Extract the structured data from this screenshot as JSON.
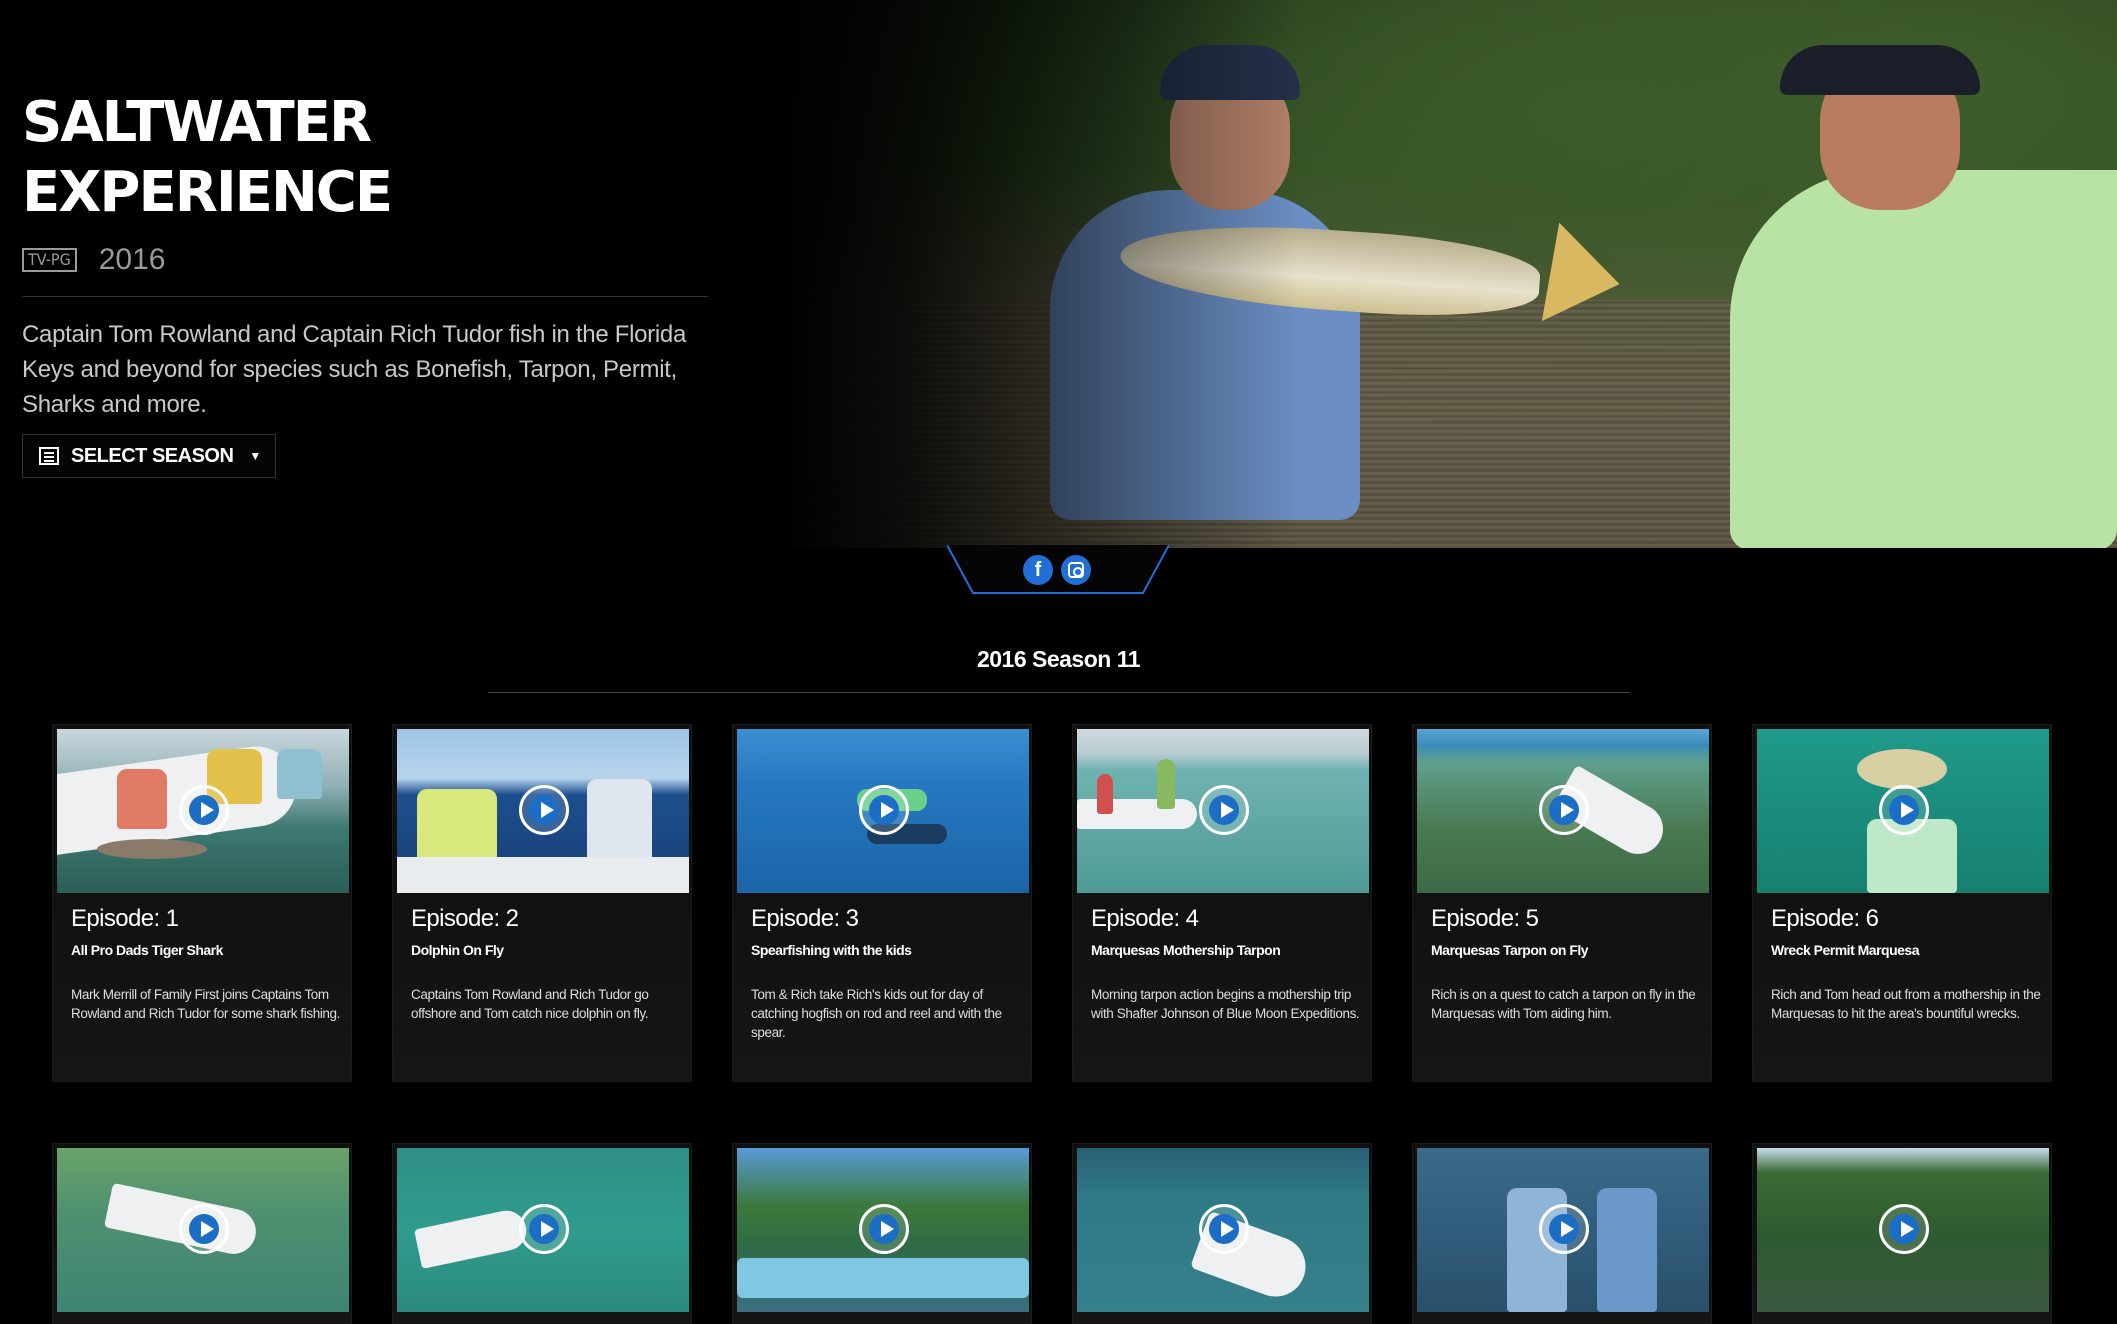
{
  "show": {
    "title": "SALTWATER EXPERIENCE",
    "rating": "TV-PG",
    "year": "2016",
    "description": "Captain Tom Rowland and Captain Rich Tudor fish in the Florida Keys and beyond for species such as Bonefish, Tarpon, Permit, Sharks and more.",
    "select_season_label": "SELECT SEASON"
  },
  "social": {
    "facebook_icon": "facebook-icon",
    "instagram_icon": "instagram-icon"
  },
  "season": {
    "heading": "2016 Season 11"
  },
  "episodes": [
    {
      "number": "Episode: 1",
      "title": "All Pro Dads Tiger Shark",
      "description": "Mark Merrill of Family First joins Captains Tom Rowland and Rich Tudor for some shark fishing."
    },
    {
      "number": "Episode: 2",
      "title": "Dolphin On Fly",
      "description": "Captains Tom Rowland and Rich Tudor go offshore and Tom catch nice dolphin on fly."
    },
    {
      "number": "Episode: 3",
      "title": "Spearfishing with the kids",
      "description": "Tom & Rich take Rich's kids out for day of catching hogfish on rod and reel and with the spear."
    },
    {
      "number": "Episode: 4",
      "title": "Marquesas Mothership Tarpon",
      "description": "Morning tarpon action begins a mothership trip with Shafter Johnson of Blue Moon Expeditions."
    },
    {
      "number": "Episode: 5",
      "title": "Marquesas Tarpon on Fly",
      "description": "Rich is on a quest to catch a tarpon on fly in the Marquesas with Tom aiding him."
    },
    {
      "number": "Episode: 6",
      "title": "Wreck Permit Marquesa",
      "description": "Rich and Tom head out from a mothership in the Marquesas to hit the area's bountiful wrecks."
    }
  ],
  "colors": {
    "accent": "#1c6dc6",
    "background": "#000000"
  }
}
